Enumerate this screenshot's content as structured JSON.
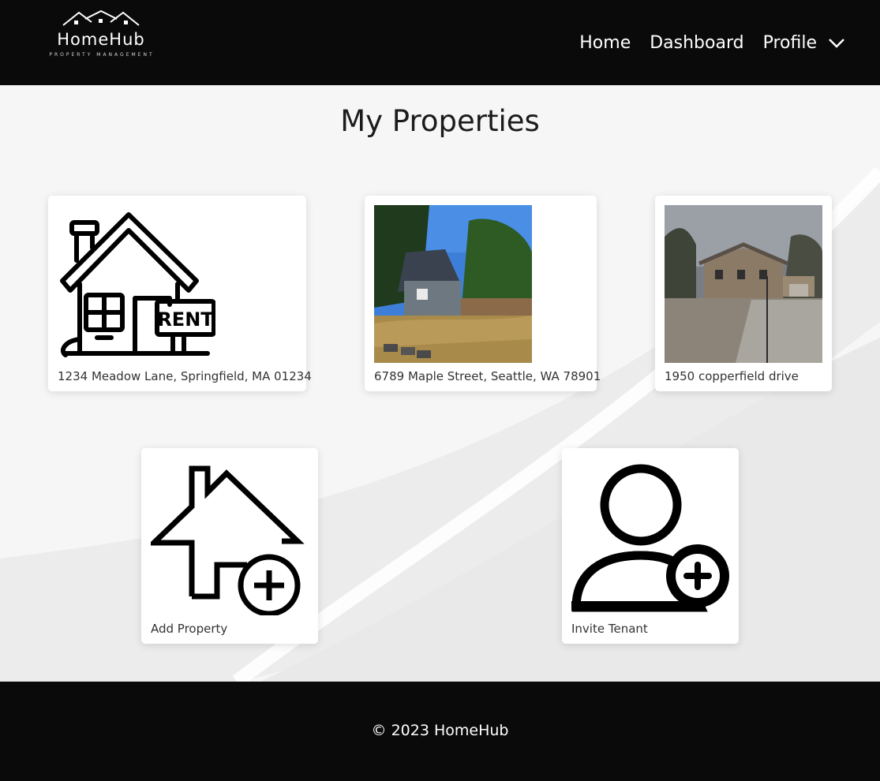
{
  "brand": {
    "name": "HomeHub",
    "tagline": "PROPERTY MANAGEMENT"
  },
  "nav": {
    "home": "Home",
    "dashboard": "Dashboard",
    "profile": "Profile"
  },
  "page": {
    "title": "My Properties"
  },
  "properties": [
    {
      "address": "1234 Meadow Lane, Springfield, MA 01234",
      "image": "house-rent-icon"
    },
    {
      "address": "6789 Maple Street, Seattle, WA 78901",
      "image": "house-photo"
    },
    {
      "address": "1950 copperfield drive",
      "image": "house-photo"
    }
  ],
  "actions": {
    "add_property": "Add Property",
    "invite_tenant": "Invite Tenant"
  },
  "footer": {
    "copyright": "© 2023 HomeHub"
  },
  "colors": {
    "header_bg": "#0a0a0a",
    "content_bg": "#f6f6f6",
    "card_bg": "#ffffff",
    "text_dark": "#1b1b1b"
  }
}
